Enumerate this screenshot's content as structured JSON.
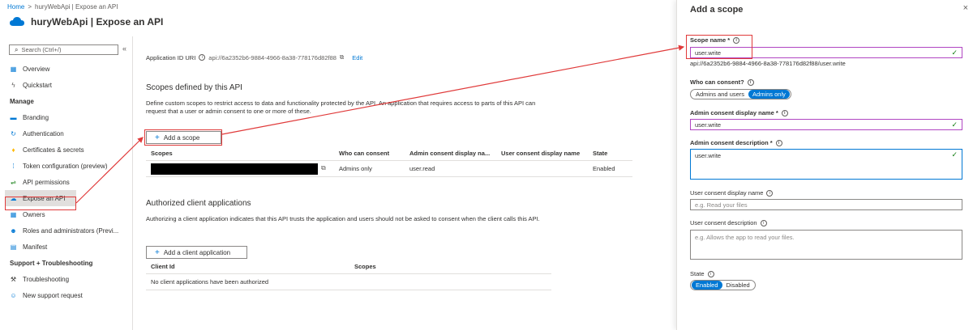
{
  "breadcrumb": {
    "home": "Home",
    "sep": ">",
    "current": "huryWebApi | Expose an API"
  },
  "page": {
    "title": "huryWebApi | Expose an API"
  },
  "sidebar": {
    "search_placeholder": "Search (Ctrl+/)",
    "collapse": "«",
    "items_top": [
      {
        "label": "Overview",
        "icon": "overview-icon"
      },
      {
        "label": "Quickstart",
        "icon": "quickstart-icon"
      }
    ],
    "section_manage": "Manage",
    "items_manage": [
      {
        "label": "Branding",
        "icon": "branding-icon"
      },
      {
        "label": "Authentication",
        "icon": "authentication-icon"
      },
      {
        "label": "Certificates & secrets",
        "icon": "key-icon"
      },
      {
        "label": "Token configuration (preview)",
        "icon": "token-icon"
      },
      {
        "label": "API permissions",
        "icon": "api-permissions-icon"
      },
      {
        "label": "Expose an API",
        "icon": "cloud-icon"
      },
      {
        "label": "Owners",
        "icon": "owners-icon"
      },
      {
        "label": "Roles and administrators (Previ...",
        "icon": "roles-icon"
      },
      {
        "label": "Manifest",
        "icon": "manifest-icon"
      }
    ],
    "section_support": "Support + Troubleshooting",
    "items_support": [
      {
        "label": "Troubleshooting",
        "icon": "wrench-icon"
      },
      {
        "label": "New support request",
        "icon": "support-icon"
      }
    ]
  },
  "main": {
    "appid_label": "Application ID URI",
    "appid_value": "api://6a2352b6-9884-4966-8a38-778176d82f88",
    "edit": "Edit",
    "scopes_title": "Scopes defined by this API",
    "scopes_desc": "Define custom scopes to restrict access to data and functionality protected by the API. An application that requires access to parts of this API can request that a user or admin consent to one or more of these.",
    "add_scope": "Add a scope",
    "scopes_table": {
      "headers": [
        "Scopes",
        "Who can consent",
        "Admin consent display na...",
        "User consent display name",
        "State"
      ],
      "rows": [
        {
          "scope": "",
          "who": "Admins only",
          "admin_display": "user.read",
          "user_display": "",
          "state": "Enabled"
        }
      ]
    },
    "clients_title": "Authorized client applications",
    "clients_desc": "Authorizing a client application indicates that this API trusts the application and users should not be asked to consent when the client calls this API.",
    "add_client": "Add a client application",
    "clients_table": {
      "headers": [
        "Client Id",
        "Scopes"
      ],
      "empty": "No client applications have been authorized"
    }
  },
  "panel": {
    "title": "Add a scope",
    "close": "×",
    "scope_name_label": "Scope name *",
    "scope_name_value": "user.write",
    "scope_uri": "api://6a2352b6-9884-4966-8a38-778176d82f88/user.write",
    "who_label": "Who can consent?",
    "who_options": [
      "Admins and users",
      "Admins only"
    ],
    "who_selected": "Admins only",
    "admin_display_label": "Admin consent display name *",
    "admin_display_value": "user.write",
    "admin_desc_label": "Admin consent description *",
    "admin_desc_value": "user.write",
    "user_display_label": "User consent display name",
    "user_display_placeholder": "e.g. Read your files",
    "user_desc_label": "User consent description",
    "user_desc_placeholder": "e.g. Allows the app to read your files.",
    "state_label": "State",
    "state_options": [
      "Enabled",
      "Disabled"
    ],
    "state_selected": "Enabled"
  },
  "colors": {
    "accent": "#0078d4",
    "annotation": "#e03a3a",
    "valid": "#107c10",
    "field_focus": "#b146c2"
  }
}
